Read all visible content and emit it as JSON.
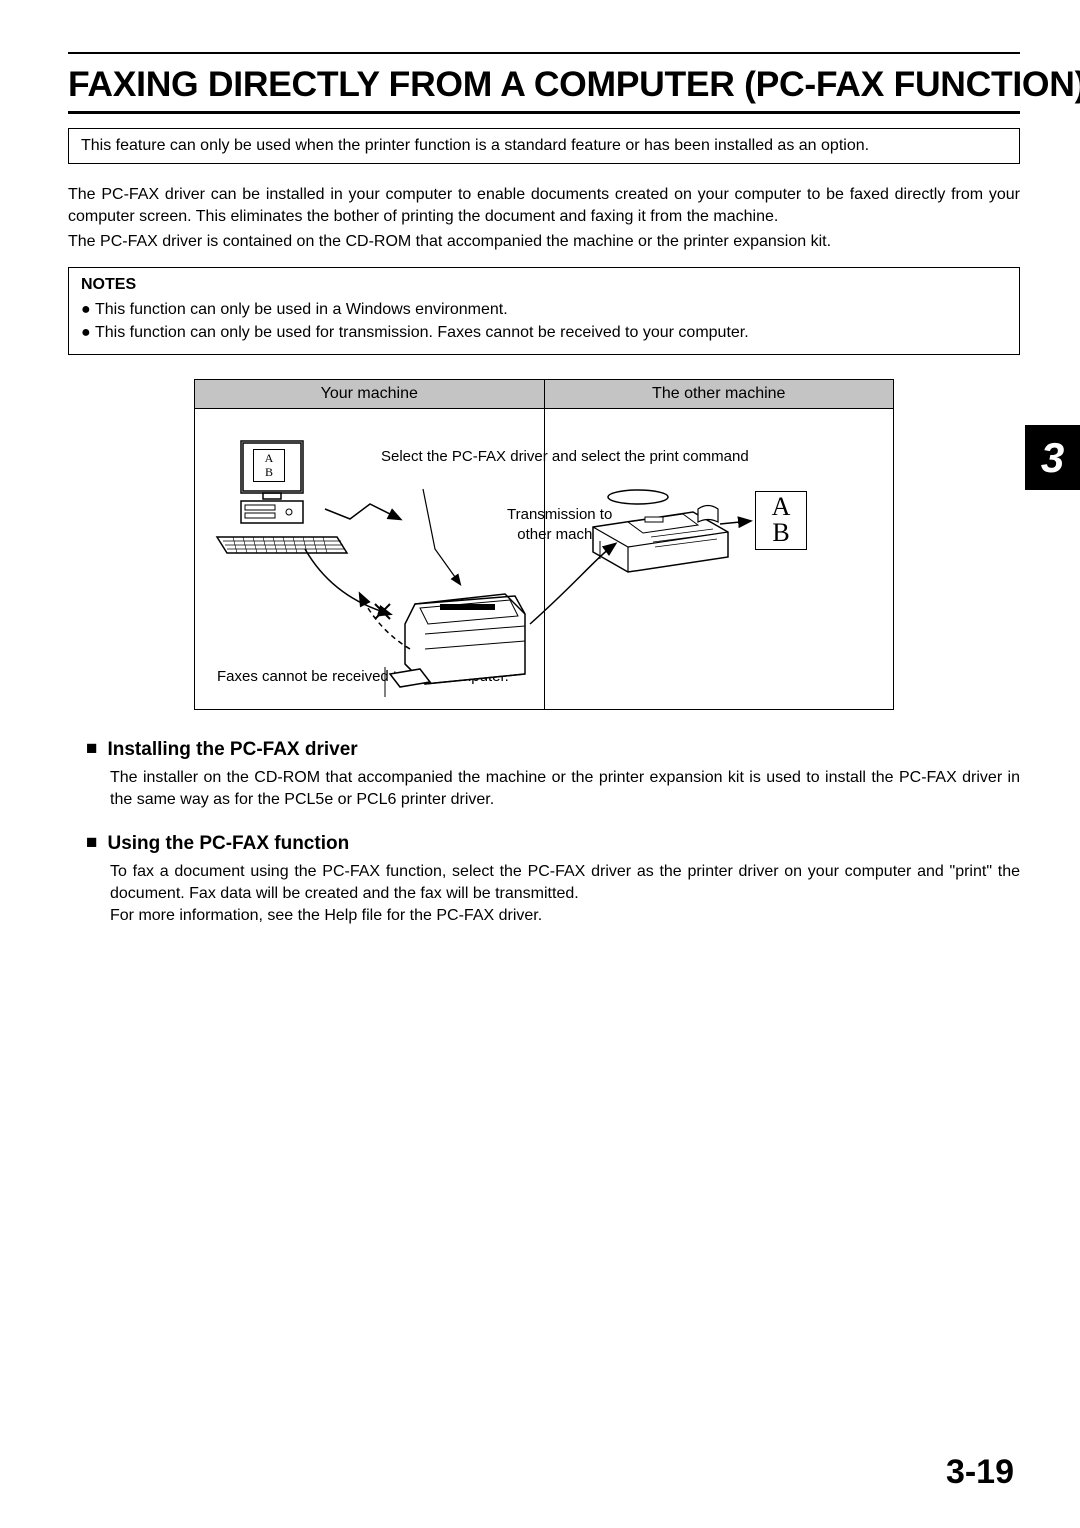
{
  "title": "FAXING DIRECTLY FROM A COMPUTER (PC-FAX FUNCTION)",
  "feature_note": "This feature can only be used when the printer function is a standard feature or has been installed as an option.",
  "intro_p1": "The PC-FAX driver can be installed in your computer to enable documents created on your computer to be faxed directly from your computer screen. This eliminates the bother of printing the document and faxing it from the machine.",
  "intro_p2": "The PC-FAX driver is contained on the CD-ROM that accompanied the machine or the printer expansion kit.",
  "notes": {
    "heading": "NOTES",
    "items": [
      "This function can only be used in a Windows environment.",
      "This function can only be used for transmission. Faxes cannot be received to your computer."
    ]
  },
  "chapter_tab": "3",
  "diagram": {
    "header_left": "Your machine",
    "header_right": "The other machine",
    "label_select": "Select the PC-FAX driver and select the print command",
    "label_trans_line1": "Transmission to",
    "label_trans_line2": "other machine",
    "label_norx": "Faxes cannot be received to your computer.",
    "screen_a": "A",
    "screen_b": "B",
    "out_a": "A",
    "out_b": "B"
  },
  "sections": [
    {
      "heading": "Installing the PC-FAX driver",
      "body": "The installer on the CD-ROM that accompanied the machine or the printer expansion kit is used to install the PC-FAX driver in the same way as for the PCL5e or PCL6 printer driver."
    },
    {
      "heading": "Using the PC-FAX function",
      "body": "To fax a document using the PC-FAX function, select the PC-FAX driver as the printer driver on your computer and \"print\" the document. Fax data will be created and the fax will be transmitted.\nFor more information, see the Help file for the PC-FAX driver."
    }
  ],
  "page_number": "3-19"
}
